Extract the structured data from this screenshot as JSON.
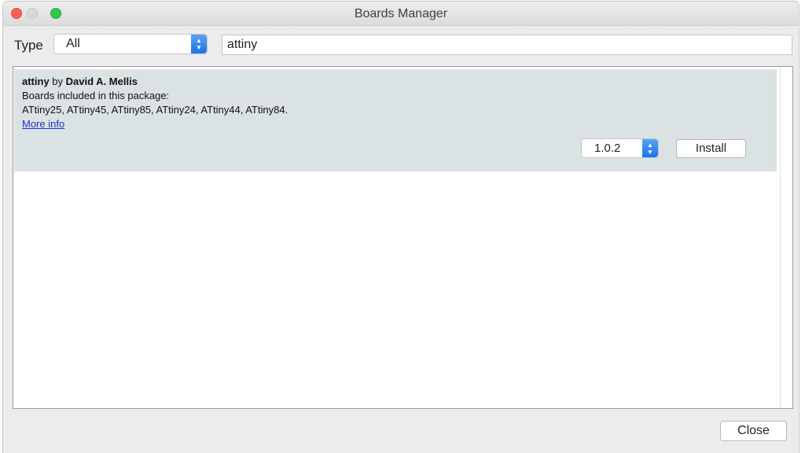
{
  "window": {
    "title": "Boards Manager"
  },
  "filter": {
    "type_label": "Type",
    "type_value": "All",
    "search_value": "attiny"
  },
  "entry": {
    "name": "attiny",
    "by": "by",
    "author": "David A. Mellis",
    "boards_heading": "Boards included in this package:",
    "boards_list": "ATtiny25, ATtiny45, ATtiny85, ATtiny24, ATtiny44, ATtiny84.",
    "more_info": "More info",
    "version": "1.0.2",
    "install_label": "Install"
  },
  "footer": {
    "close_label": "Close"
  },
  "icons": {
    "window_close": "close-light-icon",
    "window_minimize": "minimize-light-icon",
    "window_zoom": "zoom-light-icon",
    "select_arrows": "updown-chevron-icon"
  },
  "colors": {
    "accent": "#1a74ea",
    "link": "#1a33cc",
    "entry_bg": "#dbe2e3"
  }
}
